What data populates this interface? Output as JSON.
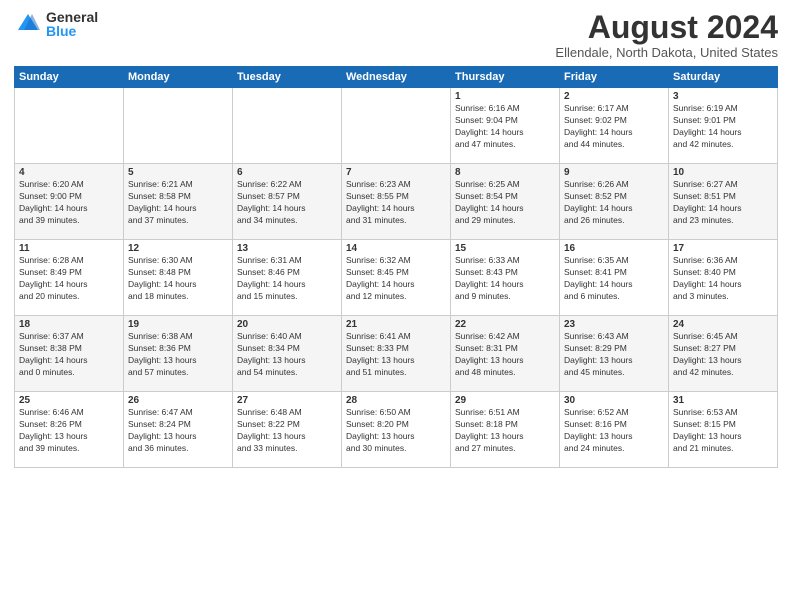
{
  "logo": {
    "general": "General",
    "blue": "Blue"
  },
  "title": "August 2024",
  "location": "Ellendale, North Dakota, United States",
  "headers": [
    "Sunday",
    "Monday",
    "Tuesday",
    "Wednesday",
    "Thursday",
    "Friday",
    "Saturday"
  ],
  "weeks": [
    [
      {
        "day": "",
        "info": ""
      },
      {
        "day": "",
        "info": ""
      },
      {
        "day": "",
        "info": ""
      },
      {
        "day": "",
        "info": ""
      },
      {
        "day": "1",
        "info": "Sunrise: 6:16 AM\nSunset: 9:04 PM\nDaylight: 14 hours\nand 47 minutes."
      },
      {
        "day": "2",
        "info": "Sunrise: 6:17 AM\nSunset: 9:02 PM\nDaylight: 14 hours\nand 44 minutes."
      },
      {
        "day": "3",
        "info": "Sunrise: 6:19 AM\nSunset: 9:01 PM\nDaylight: 14 hours\nand 42 minutes."
      }
    ],
    [
      {
        "day": "4",
        "info": "Sunrise: 6:20 AM\nSunset: 9:00 PM\nDaylight: 14 hours\nand 39 minutes."
      },
      {
        "day": "5",
        "info": "Sunrise: 6:21 AM\nSunset: 8:58 PM\nDaylight: 14 hours\nand 37 minutes."
      },
      {
        "day": "6",
        "info": "Sunrise: 6:22 AM\nSunset: 8:57 PM\nDaylight: 14 hours\nand 34 minutes."
      },
      {
        "day": "7",
        "info": "Sunrise: 6:23 AM\nSunset: 8:55 PM\nDaylight: 14 hours\nand 31 minutes."
      },
      {
        "day": "8",
        "info": "Sunrise: 6:25 AM\nSunset: 8:54 PM\nDaylight: 14 hours\nand 29 minutes."
      },
      {
        "day": "9",
        "info": "Sunrise: 6:26 AM\nSunset: 8:52 PM\nDaylight: 14 hours\nand 26 minutes."
      },
      {
        "day": "10",
        "info": "Sunrise: 6:27 AM\nSunset: 8:51 PM\nDaylight: 14 hours\nand 23 minutes."
      }
    ],
    [
      {
        "day": "11",
        "info": "Sunrise: 6:28 AM\nSunset: 8:49 PM\nDaylight: 14 hours\nand 20 minutes."
      },
      {
        "day": "12",
        "info": "Sunrise: 6:30 AM\nSunset: 8:48 PM\nDaylight: 14 hours\nand 18 minutes."
      },
      {
        "day": "13",
        "info": "Sunrise: 6:31 AM\nSunset: 8:46 PM\nDaylight: 14 hours\nand 15 minutes."
      },
      {
        "day": "14",
        "info": "Sunrise: 6:32 AM\nSunset: 8:45 PM\nDaylight: 14 hours\nand 12 minutes."
      },
      {
        "day": "15",
        "info": "Sunrise: 6:33 AM\nSunset: 8:43 PM\nDaylight: 14 hours\nand 9 minutes."
      },
      {
        "day": "16",
        "info": "Sunrise: 6:35 AM\nSunset: 8:41 PM\nDaylight: 14 hours\nand 6 minutes."
      },
      {
        "day": "17",
        "info": "Sunrise: 6:36 AM\nSunset: 8:40 PM\nDaylight: 14 hours\nand 3 minutes."
      }
    ],
    [
      {
        "day": "18",
        "info": "Sunrise: 6:37 AM\nSunset: 8:38 PM\nDaylight: 14 hours\nand 0 minutes."
      },
      {
        "day": "19",
        "info": "Sunrise: 6:38 AM\nSunset: 8:36 PM\nDaylight: 13 hours\nand 57 minutes."
      },
      {
        "day": "20",
        "info": "Sunrise: 6:40 AM\nSunset: 8:34 PM\nDaylight: 13 hours\nand 54 minutes."
      },
      {
        "day": "21",
        "info": "Sunrise: 6:41 AM\nSunset: 8:33 PM\nDaylight: 13 hours\nand 51 minutes."
      },
      {
        "day": "22",
        "info": "Sunrise: 6:42 AM\nSunset: 8:31 PM\nDaylight: 13 hours\nand 48 minutes."
      },
      {
        "day": "23",
        "info": "Sunrise: 6:43 AM\nSunset: 8:29 PM\nDaylight: 13 hours\nand 45 minutes."
      },
      {
        "day": "24",
        "info": "Sunrise: 6:45 AM\nSunset: 8:27 PM\nDaylight: 13 hours\nand 42 minutes."
      }
    ],
    [
      {
        "day": "25",
        "info": "Sunrise: 6:46 AM\nSunset: 8:26 PM\nDaylight: 13 hours\nand 39 minutes."
      },
      {
        "day": "26",
        "info": "Sunrise: 6:47 AM\nSunset: 8:24 PM\nDaylight: 13 hours\nand 36 minutes."
      },
      {
        "day": "27",
        "info": "Sunrise: 6:48 AM\nSunset: 8:22 PM\nDaylight: 13 hours\nand 33 minutes."
      },
      {
        "day": "28",
        "info": "Sunrise: 6:50 AM\nSunset: 8:20 PM\nDaylight: 13 hours\nand 30 minutes."
      },
      {
        "day": "29",
        "info": "Sunrise: 6:51 AM\nSunset: 8:18 PM\nDaylight: 13 hours\nand 27 minutes."
      },
      {
        "day": "30",
        "info": "Sunrise: 6:52 AM\nSunset: 8:16 PM\nDaylight: 13 hours\nand 24 minutes."
      },
      {
        "day": "31",
        "info": "Sunrise: 6:53 AM\nSunset: 8:15 PM\nDaylight: 13 hours\nand 21 minutes."
      }
    ]
  ]
}
